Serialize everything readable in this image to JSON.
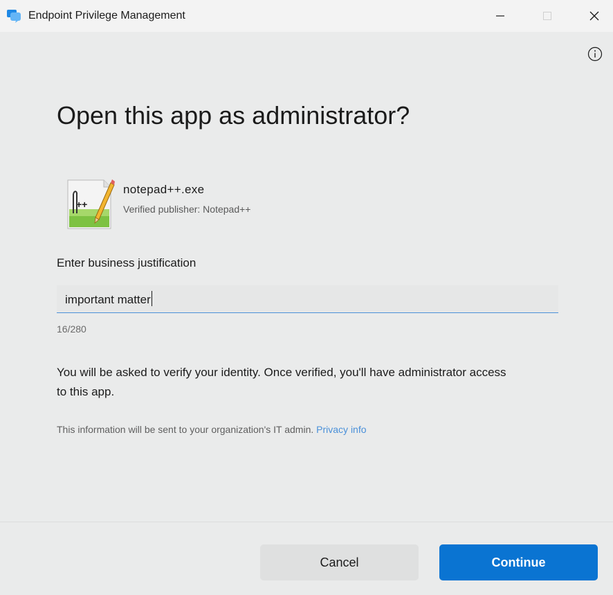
{
  "window": {
    "title": "Endpoint Privilege Management"
  },
  "dialog": {
    "heading": "Open this app as administrator?",
    "app": {
      "file_name": "notepad++.exe",
      "publisher": "Verified publisher: Notepad++"
    },
    "justification": {
      "label": "Enter business justification",
      "value": "important matter",
      "counter": "16/280"
    },
    "verify_text": "You will be asked to verify your identity. Once verified, you'll have administrator access to this app.",
    "info_text": "This information will be sent to your organization's IT admin.",
    "privacy_link": "Privacy info"
  },
  "buttons": {
    "cancel": "Cancel",
    "continue": "Continue"
  },
  "colors": {
    "accent": "#0a74d2",
    "link": "#4a90d9",
    "background": "#eaebeb"
  },
  "icons": {
    "app": "endpoint-privilege-management-icon",
    "file": "notepad-plus-plus-icon",
    "info": "info-icon",
    "minimize": "minimize-icon",
    "maximize": "maximize-icon",
    "close": "close-icon"
  }
}
